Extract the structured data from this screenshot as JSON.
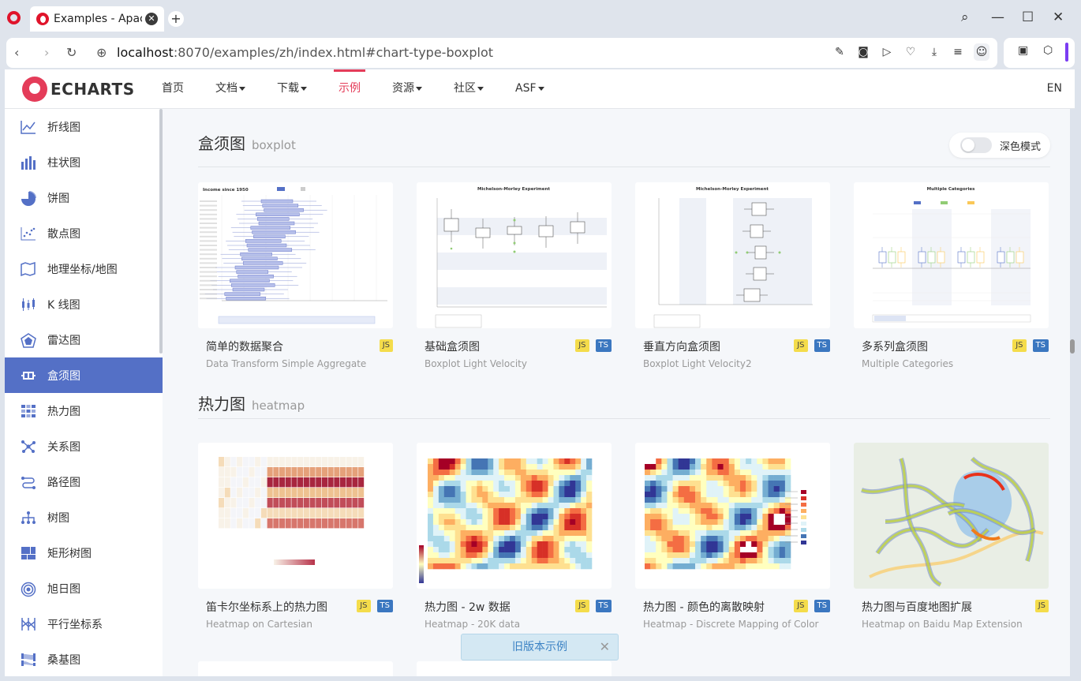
{
  "browser": {
    "tab_title": "Examples - Apache E",
    "url_host": "localhost",
    "url_rest": ":8070/examples/zh/index.html#chart-type-boxplot"
  },
  "header": {
    "logo_text": "ECHARTS",
    "nav": [
      "首页",
      "文档",
      "下载",
      "示例",
      "资源",
      "社区",
      "ASF"
    ],
    "active_nav": "示例",
    "lang": "EN"
  },
  "sidebar": {
    "items": [
      {
        "label": "折线图",
        "icon": "line-chart-icon"
      },
      {
        "label": "柱状图",
        "icon": "bar-chart-icon"
      },
      {
        "label": "饼图",
        "icon": "pie-chart-icon"
      },
      {
        "label": "散点图",
        "icon": "scatter-chart-icon"
      },
      {
        "label": "地理坐标/地图",
        "icon": "map-icon"
      },
      {
        "label": "K 线图",
        "icon": "candlestick-icon"
      },
      {
        "label": "雷达图",
        "icon": "radar-icon"
      },
      {
        "label": "盒须图",
        "icon": "boxplot-icon"
      },
      {
        "label": "热力图",
        "icon": "heatmap-icon"
      },
      {
        "label": "关系图",
        "icon": "graph-icon"
      },
      {
        "label": "路径图",
        "icon": "lines-icon"
      },
      {
        "label": "树图",
        "icon": "tree-icon"
      },
      {
        "label": "矩形树图",
        "icon": "treemap-icon"
      },
      {
        "label": "旭日图",
        "icon": "sunburst-icon"
      },
      {
        "label": "平行坐标系",
        "icon": "parallel-icon"
      },
      {
        "label": "桑基图",
        "icon": "sankey-icon"
      }
    ],
    "active_index": 7
  },
  "main": {
    "dark_mode_label": "深色模式",
    "sections": [
      {
        "title": "盒须图",
        "subtitle": "boxplot",
        "cards": [
          {
            "title": "简单的数据聚合",
            "subtitle": "Data Transform Simple Aggregate",
            "js": true,
            "ts": false
          },
          {
            "title": "基础盒须图",
            "subtitle": "Boxplot Light Velocity",
            "js": true,
            "ts": true
          },
          {
            "title": "垂直方向盒须图",
            "subtitle": "Boxplot Light Velocity2",
            "js": true,
            "ts": true
          },
          {
            "title": "多系列盒须图",
            "subtitle": "Multiple Categories",
            "js": true,
            "ts": true
          }
        ]
      },
      {
        "title": "热力图",
        "subtitle": "heatmap",
        "cards": [
          {
            "title": "笛卡尔坐标系上的热力图",
            "subtitle": "Heatmap on Cartesian",
            "js": true,
            "ts": true
          },
          {
            "title": "热力图 - 2w 数据",
            "subtitle": "Heatmap - 20K data",
            "js": true,
            "ts": true
          },
          {
            "title": "热力图 - 颜色的离散映射",
            "subtitle": "Heatmap - Discrete Mapping of Color",
            "js": true,
            "ts": true
          },
          {
            "title": "热力图与百度地图扩展",
            "subtitle": "Heatmap on Baidu Map Extension",
            "js": true,
            "ts": false
          }
        ]
      }
    ],
    "thumb_texts": {
      "income_title": "Income since 1950",
      "mm_title": "Michelson-Morley Experiment",
      "multi_title": "Multiple Categories"
    },
    "tag_js": "JS",
    "tag_ts": "TS",
    "old_version": "旧版本示例"
  },
  "colors": {
    "accent": "#5470c6",
    "brand_red": "#e43c59"
  }
}
